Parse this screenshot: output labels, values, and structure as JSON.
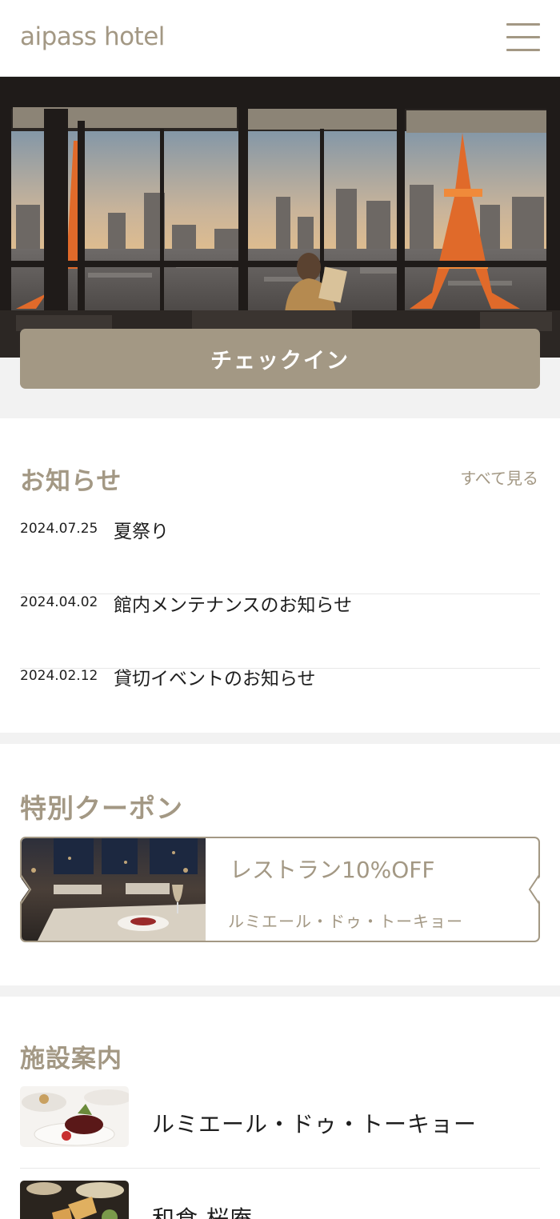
{
  "header": {
    "logo": "aipass hotel",
    "menu_icon": "hamburger-menu-icon"
  },
  "hero": {
    "checkin_label": "チェックイン"
  },
  "news": {
    "title": "お知らせ",
    "see_all": "すべて見る",
    "items": [
      {
        "date": "2024.07.25",
        "title": "夏祭り"
      },
      {
        "date": "2024.04.02",
        "title": "館内メンテナンスのお知らせ"
      },
      {
        "date": "2024.02.12",
        "title": "貸切イベントのお知らせ"
      }
    ]
  },
  "coupons": {
    "title": "特別クーポン",
    "items": [
      {
        "title": "レストラン10%OFF",
        "subtitle": "ルミエール・ドゥ・トーキョー"
      }
    ]
  },
  "facilities": {
    "title": "施設案内",
    "items": [
      {
        "name": "ルミエール・ドゥ・トーキョー"
      },
      {
        "name": "和食 桜庵"
      }
    ]
  },
  "colors": {
    "accent": "#a39884",
    "text": "#1e1e1e",
    "background": "#f2f2f2"
  }
}
